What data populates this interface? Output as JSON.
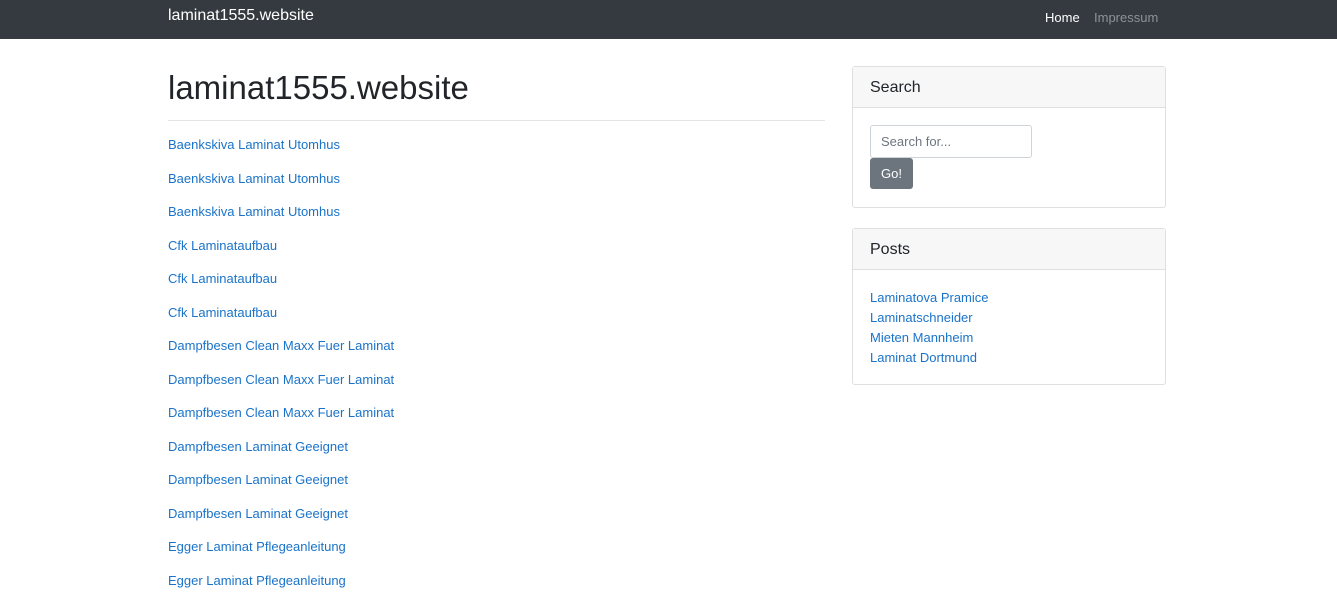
{
  "navbar": {
    "brand": "laminat1555.website",
    "links": [
      {
        "label": "Home"
      },
      {
        "label": "Impressum"
      }
    ]
  },
  "main": {
    "title": "laminat1555.website",
    "links": [
      "Baenkskiva Laminat Utomhus",
      "Baenkskiva Laminat Utomhus",
      "Baenkskiva Laminat Utomhus",
      "Cfk Laminataufbau",
      "Cfk Laminataufbau",
      "Cfk Laminataufbau",
      "Dampfbesen Clean Maxx Fuer Laminat",
      "Dampfbesen Clean Maxx Fuer Laminat",
      "Dampfbesen Clean Maxx Fuer Laminat",
      "Dampfbesen Laminat Geeignet",
      "Dampfbesen Laminat Geeignet",
      "Dampfbesen Laminat Geeignet",
      "Egger Laminat Pflegeanleitung",
      "Egger Laminat Pflegeanleitung"
    ]
  },
  "sidebar": {
    "search": {
      "title": "Search",
      "placeholder": "Search for...",
      "button_label": "Go!"
    },
    "posts": {
      "title": "Posts",
      "items": [
        "Laminatova Pramice",
        "Laminatschneider",
        "Mieten Mannheim",
        "Laminat Dortmund"
      ]
    }
  },
  "colors": {
    "navbar_bg": "#343a40",
    "link": "#1a73c9",
    "button_bg": "#6c757d"
  }
}
